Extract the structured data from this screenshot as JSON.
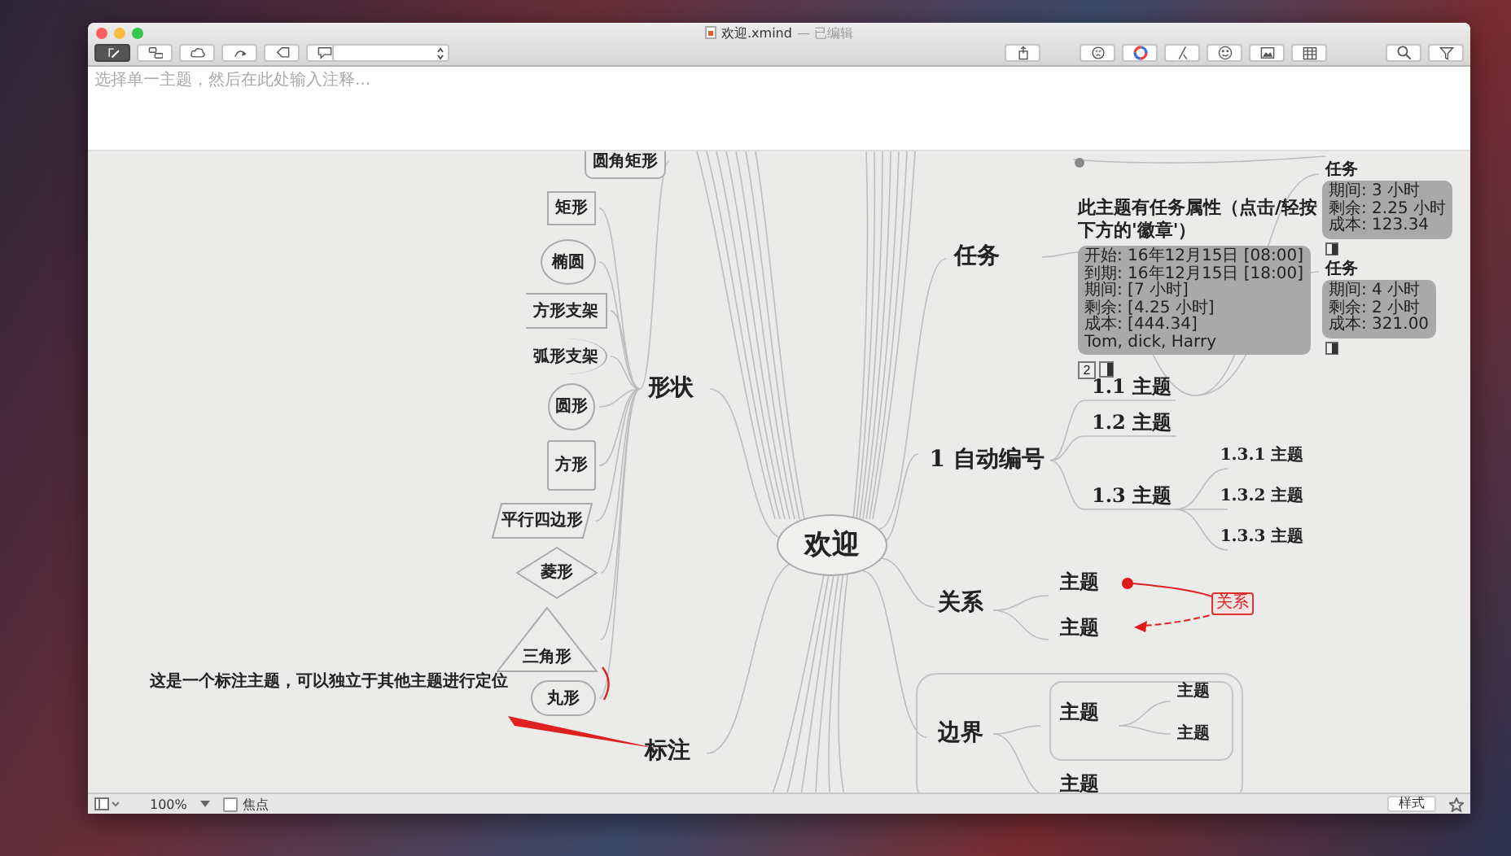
{
  "window": {
    "title": "欢迎.xmind",
    "status": "— 已编辑"
  },
  "toolbar": {
    "left_tools": [
      {
        "kind": "pencil",
        "selected": true
      },
      {
        "kind": "linked",
        "selected": false
      },
      {
        "kind": "cloud",
        "selected": false
      },
      {
        "kind": "curve",
        "selected": false
      },
      {
        "kind": "tag",
        "selected": false
      },
      {
        "kind": "bubble",
        "selected": false
      }
    ],
    "right_tools": [
      {
        "kind": "share"
      },
      {
        "kind": "face"
      },
      {
        "kind": "colors"
      },
      {
        "kind": "stroke"
      },
      {
        "kind": "smiley"
      },
      {
        "kind": "image"
      },
      {
        "kind": "grid"
      },
      {
        "kind": "search"
      },
      {
        "kind": "filter"
      }
    ]
  },
  "notes": {
    "placeholder": "选择单一主题，然后在此处输入注释..."
  },
  "mindmap": {
    "central": "欢迎",
    "shapes": {
      "label": "形状",
      "children": [
        {
          "label": "圆角矩形",
          "kind": "rounded"
        },
        {
          "label": "矩形",
          "kind": "rect"
        },
        {
          "label": "椭圆",
          "kind": "ellipse"
        },
        {
          "label": "方形支架",
          "kind": "square-bracket"
        },
        {
          "label": "弧形支架",
          "kind": "arc-bracket"
        },
        {
          "label": "圆形",
          "kind": "circle"
        },
        {
          "label": "方形",
          "kind": "square"
        },
        {
          "label": "平行四边形",
          "kind": "parallelogram"
        },
        {
          "label": "菱形",
          "kind": "diamond"
        },
        {
          "label": "三角形",
          "kind": "triangle"
        },
        {
          "label": "丸形",
          "kind": "capsule"
        }
      ]
    },
    "callout": {
      "label": "标注",
      "note": "这是一个标注主题，可以独立于其他主题进行定位"
    },
    "task": {
      "label": "任务",
      "topic": "此主题有任务属性（点击/轻按下方的'徽章'）",
      "info": [
        "开始: 16年12月15日 [08:00]",
        "到期: 16年12月15日 [18:00]",
        "期间: [7 小时]",
        "剩余: [4.25 小时]",
        "成本: [444.34]",
        "Tom, dick, Harry"
      ],
      "priority": "2",
      "subtasks": [
        {
          "label": "任务",
          "info": [
            "期间: 3 小时",
            "剩余: 2.25 小时",
            "成本: 123.34"
          ]
        },
        {
          "label": "任务",
          "info": [
            "期间: 4 小时",
            "剩余: 2 小时",
            "成本: 321.00"
          ]
        }
      ]
    },
    "numbering": {
      "label": "1 自动编号",
      "children": [
        {
          "label": "1.1 主题"
        },
        {
          "label": "1.2 主题"
        },
        {
          "label": "1.3 主题",
          "children": [
            "1.3.1 主题",
            "1.3.2 主题",
            "1.3.3 主题"
          ]
        }
      ]
    },
    "relationship": {
      "label": "关系",
      "topics": [
        "主题",
        "主题"
      ],
      "link_label": "关系"
    },
    "boundary": {
      "label": "边界",
      "children": [
        {
          "label": "主题",
          "children": [
            "主题",
            "主题"
          ]
        },
        {
          "label": "主题"
        }
      ]
    }
  },
  "status_bar": {
    "zoom": "100%",
    "focus": {
      "label": "焦点",
      "checked": false
    },
    "style_button": "样式"
  }
}
